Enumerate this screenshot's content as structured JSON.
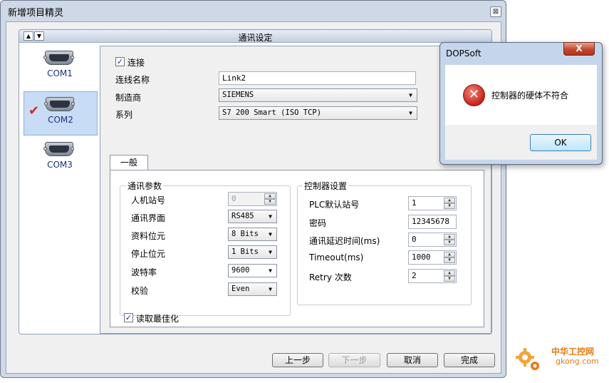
{
  "main_window": {
    "title": "新增项目精灵",
    "close_glyph": "⊠",
    "group_title": "通讯设定",
    "header_up": "▲",
    "header_down": "▼"
  },
  "com_ports": [
    {
      "label": "COM1",
      "selected": false
    },
    {
      "label": "COM2",
      "selected": true
    },
    {
      "label": "COM3",
      "selected": false
    }
  ],
  "selected_check": "✔",
  "connection": {
    "connect_checked": true,
    "connect_label": "连接",
    "name_label": "连线名称",
    "name_value": "Link2",
    "manufacturer_label": "制造商",
    "manufacturer_value": "SIEMENS",
    "series_label": "系列",
    "series_value": "S7 200 Smart (ISO TCP)"
  },
  "tab": {
    "general_label": "一般"
  },
  "comm_params": {
    "title": "通讯参数",
    "hmi_station_label": "人机站号",
    "hmi_station_value": "0",
    "interface_label": "通讯界面",
    "interface_value": "RS485",
    "data_bits_label": "资料位元",
    "data_bits_value": "8 Bits",
    "stop_bits_label": "停止位元",
    "stop_bits_value": "1 Bits",
    "baud_label": "波特率",
    "baud_value": "9600",
    "parity_label": "校验",
    "parity_value": "Even"
  },
  "controller_settings": {
    "title": "控制器设置",
    "plc_station_label": "PLC默认站号",
    "plc_station_value": "1",
    "password_label": "密码",
    "password_value": "12345678",
    "delay_label": "通讯延迟时间(ms)",
    "delay_value": "0",
    "timeout_label": "Timeout(ms)",
    "timeout_value": "1000",
    "retry_label": "Retry 次数",
    "retry_value": "2"
  },
  "optimize": {
    "checked": true,
    "label": "读取最佳化"
  },
  "buttons": {
    "prev": "上一步",
    "next": "下一步",
    "cancel": "取消",
    "finish": "完成"
  },
  "dialog": {
    "title": "DOPSoft",
    "close_glyph": "X",
    "message": "控制器的硬体不符合",
    "error_glyph": "✕",
    "ok": "OK"
  },
  "watermark": {
    "text": "中华工控网",
    "sub": "gkong.com"
  },
  "glyphs": {
    "check": "✓",
    "up": "▲",
    "down": "▼"
  },
  "colors": {
    "com_label": "#1b2f86",
    "selection_bg": "#c9dcf5",
    "error_red": "#c8231b",
    "watermark": "#e87a12"
  }
}
